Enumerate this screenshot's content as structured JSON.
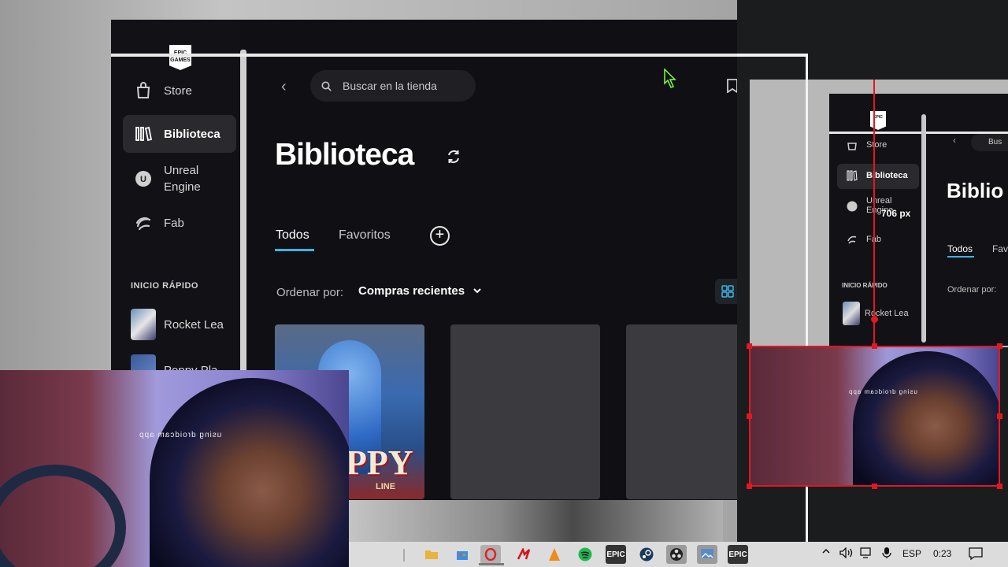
{
  "window": {
    "logo_text": "EPIC GAMES",
    "sidebar": {
      "items": [
        {
          "label": "Store",
          "icon": "bag-icon"
        },
        {
          "label": "Biblioteca",
          "icon": "library-icon",
          "active": true
        },
        {
          "label": "Unreal Engine",
          "icon": "unreal-icon"
        },
        {
          "label": "Fab",
          "icon": "fab-icon"
        }
      ],
      "quick_launch_title": "INICIO RÁPIDO",
      "quick_launch": [
        "Rocket Lea",
        "Poppy Pla"
      ]
    },
    "search_placeholder": "Buscar en la tienda",
    "title": "Biblioteca",
    "tabs": [
      {
        "label": "Todos",
        "active": true
      },
      {
        "label": "Favoritos"
      }
    ],
    "sort_label": "Ordenar por:",
    "sort_value": "Compras recientes",
    "cards": [
      {
        "label": "PPY",
        "subtitle": "LINE"
      },
      {
        "label": ""
      },
      {
        "label": ""
      }
    ]
  },
  "capture": {
    "logo_text": "EPIC",
    "sidebar": [
      "Store",
      "Biblioteca",
      "Unreal Engine",
      "Fab"
    ],
    "quick_title": "INICIO RÁPIDO",
    "quick_item": "Rocket Lea",
    "title": "Biblio",
    "tabs": [
      "Todos",
      "Fav"
    ],
    "sort_label": "Ordenar por:",
    "search_label": "Bus",
    "measurement": "706 px"
  },
  "webcam": {
    "watermark": "using droidcam app"
  },
  "taskbar": {
    "apps": [
      "file-explorer",
      "store",
      "opera",
      "brave",
      "vlc",
      "spotify",
      "epic-games",
      "steam",
      "obs",
      "photos",
      "epic-games-2"
    ],
    "epic_label": "EPIC",
    "language": "ESP",
    "time": "0:23"
  },
  "colors": {
    "accent": "#3cb3e6",
    "selection_red": "#e01820"
  }
}
